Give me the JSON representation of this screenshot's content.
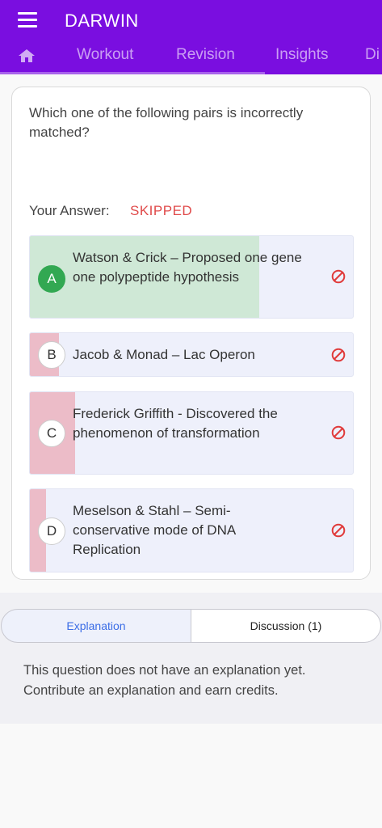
{
  "app": {
    "title": "DARWIN"
  },
  "tabs": [
    "Workout",
    "Revision",
    "Insights",
    "Di"
  ],
  "question": {
    "text": "Which one of the following pairs is incorrectly matched?",
    "answer_label": "Your Answer:",
    "answer_value": "SKIPPED"
  },
  "options": [
    {
      "letter": "A",
      "text": "Watson & Crick – Proposed one gene one polypeptide hypothesis",
      "response_share": 0.71,
      "is_correct": true
    },
    {
      "letter": "B",
      "text": "Jacob & Monad – Lac Operon",
      "response_share": 0.09,
      "is_correct": false
    },
    {
      "letter": "C",
      "text": "Frederick Griffith - Discovered the phenomenon of transformation",
      "response_share": 0.14,
      "is_correct": false
    },
    {
      "letter": "D",
      "text": "Meselson & Stahl – Semi-conservative mode of DNA Replication",
      "response_share": 0.05,
      "is_correct": false
    }
  ],
  "footer_tabs": {
    "explanation": "Explanation",
    "discussion": "Discussion (1)"
  },
  "explanation_text": "This question does not have an explanation yet. Contribute an explanation and earn credits.",
  "colors": {
    "brand": "#7a0ee0",
    "correct_fill": "#cfe8d6",
    "wrong_fill": "#ecbcc8",
    "skipped": "#e04a4a",
    "link": "#3b6de6"
  },
  "icons": [
    "menu-icon",
    "home-icon",
    "block-icon"
  ]
}
